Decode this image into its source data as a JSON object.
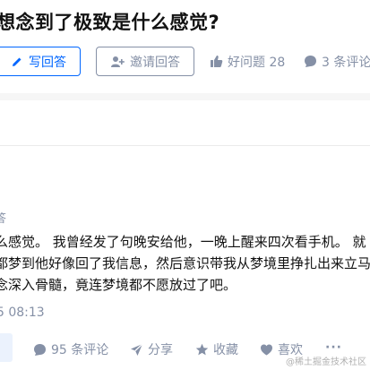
{
  "question": {
    "title": "想念到了极致是什么感觉?",
    "write_answer_label": "写回答",
    "invite_answer_label": "邀请回答",
    "good_question_label": "好问题 28",
    "comments_label": "3 条评论"
  },
  "answer": {
    "author_tail": "答",
    "lines": [
      "么感觉。 我曾经发了句晚安给他，一晚上醒来四次看手机。 就",
      "都梦到他好像回了我信息，然后意识带我从梦境里挣扎出来立马",
      "念深入骨髓，竟连梦境都不愿放过了吧。"
    ],
    "date": "5 08:13",
    "actions": {
      "comment": "95 条评论",
      "share": "分享",
      "favorite": "收藏",
      "like": "喜欢",
      "more": "···"
    }
  },
  "watermark": "@稀土掘金技术社区",
  "colors": {
    "accent": "#0066ff",
    "muted": "#8590a6",
    "background": "#f6f6f6"
  }
}
